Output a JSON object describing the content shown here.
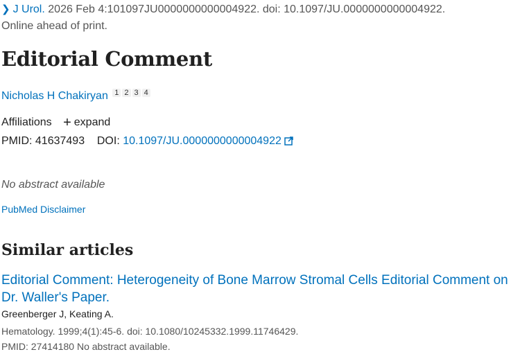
{
  "citation": {
    "journal": "J Urol.",
    "details": "2026 Feb 4:101097JU0000000000004922. doi: 10.1097/JU.0000000000004922.",
    "status": "Online ahead of print."
  },
  "article": {
    "title": "Editorial Comment",
    "author": "Nicholas H Chakiryan",
    "author_sups": [
      "1",
      "2",
      "3",
      "4"
    ],
    "affiliations_label": "Affiliations",
    "expand_label": "expand",
    "pmid_label": "PMID:",
    "pmid_value": "41637493",
    "doi_label": "DOI:",
    "doi_value": "10.1097/JU.0000000000004922",
    "no_abstract": "No abstract available",
    "disclaimer": "PubMed Disclaimer"
  },
  "similar": {
    "heading": "Similar articles",
    "items": [
      {
        "title": "Editorial Comment: Heterogeneity of Bone Marrow Stromal Cells Editorial Comment on Dr. Waller's Paper.",
        "authors": "Greenberger J, Keating A.",
        "citation": "Hematology. 1999;4(1):45-6. doi: 10.1080/10245332.1999.11746429.",
        "next_line": "PMID: 27414180   No abstract available."
      }
    ]
  },
  "colors": {
    "link": "#0071bc",
    "text": "#212121",
    "muted": "#555555"
  }
}
